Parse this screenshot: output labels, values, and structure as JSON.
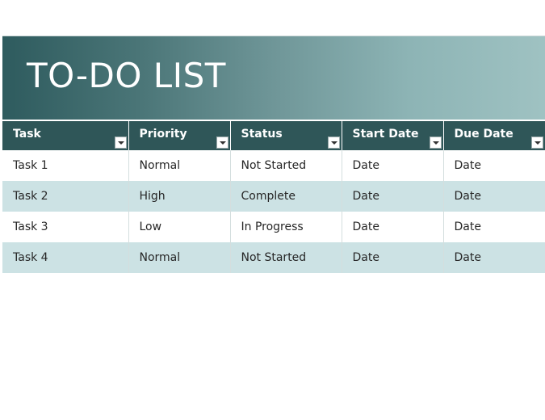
{
  "banner": {
    "title": "TO-DO LIST"
  },
  "table": {
    "headers": [
      "Task",
      "Priority",
      "Status",
      "Start Date",
      "Due Date"
    ],
    "rows": [
      [
        "Task 1",
        "Normal",
        "Not Started",
        "Date",
        "Date"
      ],
      [
        "Task 2",
        "High",
        "Complete",
        "Date",
        "Date"
      ],
      [
        "Task 3",
        "Low",
        "In Progress",
        "Date",
        "Date"
      ],
      [
        "Task 4",
        "Normal",
        "Not Started",
        "Date",
        "Date"
      ]
    ]
  },
  "icons": {
    "filter": "filter-dropdown-icon"
  },
  "colors": {
    "header_bg": "#2f5658",
    "banner_dark": "#2e5b5e",
    "banner_light": "#9fc2c2",
    "band_row": "#cce2e4",
    "text": "#262626"
  }
}
